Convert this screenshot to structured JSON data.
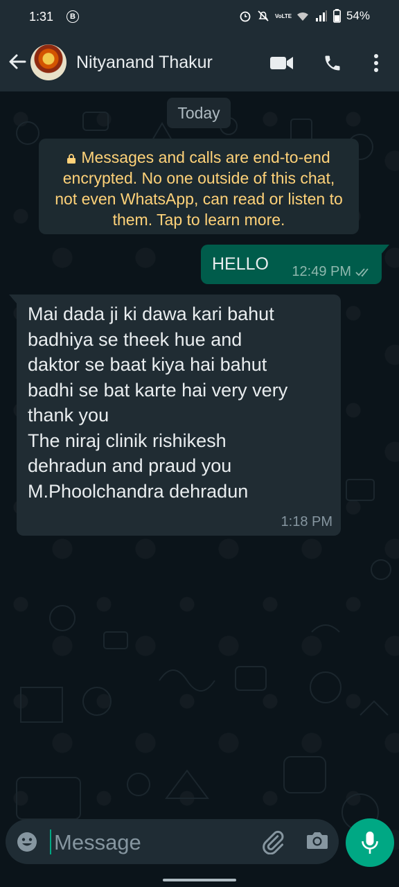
{
  "status_bar": {
    "time": "1:31",
    "b_badge": "B",
    "network_label": "VoLTE",
    "battery_percent": "54%"
  },
  "header": {
    "contact_name": "Nityanand Thakur",
    "icons": [
      "back-arrow-icon",
      "avatar",
      "video-call-icon",
      "voice-call-icon",
      "more-options-icon"
    ]
  },
  "chat": {
    "date_chip": "Today",
    "encryption_notice": "Messages and calls are end-to-end encrypted. No one outside of this chat, not even WhatsApp, can read or listen to them. Tap to learn more.",
    "messages": [
      {
        "direction": "outgoing",
        "text": "HELLO",
        "time": "12:49 PM",
        "status": "read"
      },
      {
        "direction": "incoming",
        "text": "Mai dada ji ki dawa kari bahut\nbadhiya se theek hue and\ndaktor se baat kiya hai bahut\nbadhi se bat karte hai very very\nthank you\nThe niraj clinik rishikesh\ndehradun and praud you\nM.Phoolchandra dehradun",
        "time": "1:18 PM"
      }
    ]
  },
  "composer": {
    "placeholder": "Message",
    "value": ""
  },
  "colors": {
    "background": "#0b141a",
    "bar": "#1f2c34",
    "outgoing_bubble": "#005c4b",
    "incoming_bubble": "#202c33",
    "accent": "#00a884",
    "notice_text": "#ffd279"
  }
}
